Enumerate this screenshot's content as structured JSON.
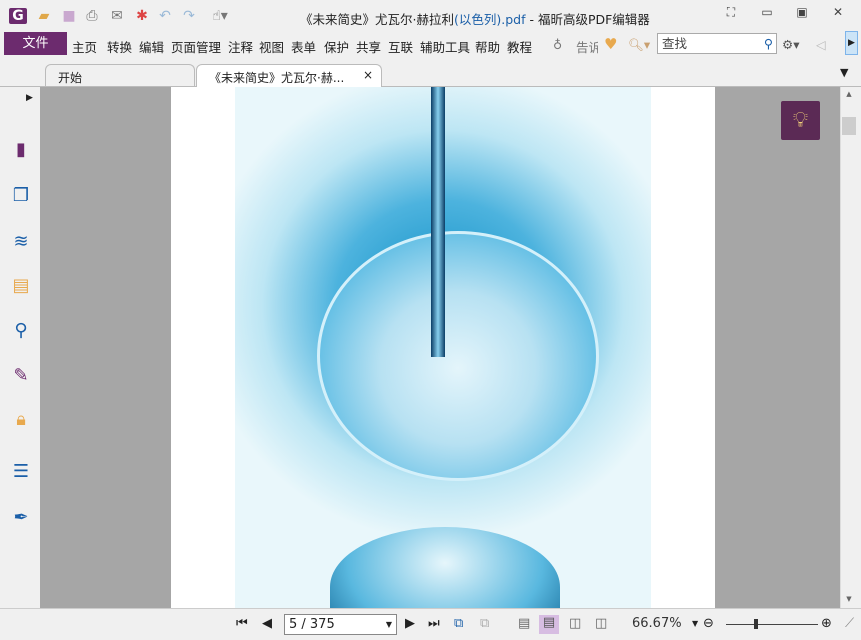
{
  "title": {
    "prefix": "《未来简史》尤瓦尔·赫拉利",
    "suffix": "(以色列).pdf",
    "app": " - 福昕高级PDF编辑器"
  },
  "menu": {
    "file": "文件",
    "items": [
      "主页",
      "转换",
      "编辑",
      "页面管理",
      "注释",
      "视图",
      "表单",
      "保护",
      "共享",
      "互联",
      "辅助工具",
      "帮助",
      "教程"
    ],
    "tell": "告诉"
  },
  "search": {
    "placeholder": "查找"
  },
  "tabs": [
    {
      "label": "开始"
    },
    {
      "label": "《未来简史》尤瓦尔·赫...",
      "close": "×"
    }
  ],
  "status": {
    "page": "5 / 375",
    "zoom": "66.67%"
  },
  "colors": {
    "accent": "#6c2b6e"
  }
}
